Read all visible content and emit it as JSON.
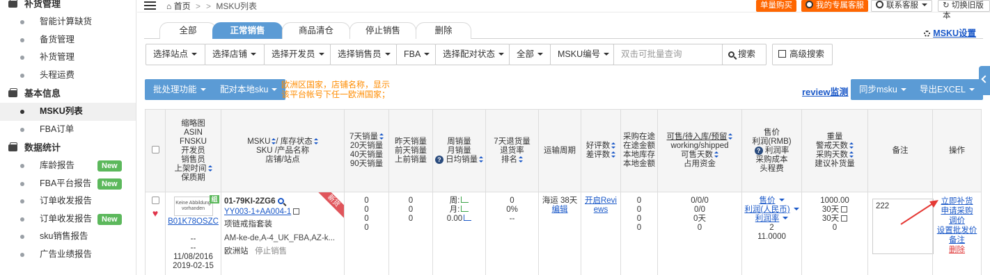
{
  "sidebar": {
    "sections": [
      {
        "title": "补货管理",
        "items": [
          {
            "label": "智能计算缺货",
            "new": ""
          },
          {
            "label": "备货管理",
            "new": ""
          },
          {
            "label": "补货管理",
            "new": ""
          },
          {
            "label": "头程运费",
            "new": ""
          }
        ]
      },
      {
        "title": "基本信息",
        "items": [
          {
            "label": "MSKU列表",
            "new": "",
            "active": true
          },
          {
            "label": "FBA订单",
            "new": ""
          }
        ]
      },
      {
        "title": "数据统计",
        "items": [
          {
            "label": "库龄报告",
            "new": "New"
          },
          {
            "label": "FBA平台报告",
            "new": "New"
          },
          {
            "label": "订单收发报告",
            "new": ""
          },
          {
            "label": "订单收发报告",
            "new": "New"
          },
          {
            "label": "sku销售报告",
            "new": ""
          },
          {
            "label": "广告业绩报告",
            "new": ""
          }
        ]
      }
    ]
  },
  "topbar": {
    "home": "首页",
    "sep1": ">",
    "sep2": ">",
    "current": "MSKU列表",
    "buy_btn": "单量购买",
    "service_btn": "我的专属客服",
    "contact_btn": "联系客服",
    "switch_btn": "切换旧版本"
  },
  "tabs": [
    {
      "label": "全部",
      "active": false
    },
    {
      "label": "正常销售",
      "active": true
    },
    {
      "label": "商品清仓",
      "active": false
    },
    {
      "label": "停止销售",
      "active": false
    },
    {
      "label": "删除",
      "active": false
    }
  ],
  "msku_settings": "MSKU设置",
  "filters": {
    "site": "选择站点",
    "shop": "选择店铺",
    "developer": "选择开发员",
    "seller": "选择销售员",
    "fba": "FBA",
    "match_status": "选择配对状态",
    "all": "全部",
    "msku_no": "MSKU编号",
    "search_placeholder": "双击可批量查询",
    "search_btn": "搜索",
    "advanced_btn": "高级搜索"
  },
  "actions": {
    "batch": "批处理功能",
    "pair": "配对本地sku",
    "note_line1": "欧洲区国家，店铺名称，显示",
    "note_line2": "该平台帐号下任一欧洲国家；",
    "review": "review监测",
    "sync": "同步msku",
    "export": "导出EXCEL"
  },
  "table": {
    "headers": {
      "thumb": [
        "缩略图",
        "ASIN",
        "FNSKU",
        "开发员",
        "销售员",
        "上架时间",
        "保质期"
      ],
      "msku": [
        "MSKU",
        "/ 库存状态",
        "SKU /产品名称",
        "店铺/站点"
      ],
      "sales7": [
        "7天销量",
        "20天销量",
        "40天销量",
        "90天销量"
      ],
      "yesterday": [
        "昨天销量",
        "前天销量",
        "上前销量"
      ],
      "weekly": [
        "周销量",
        "月销量",
        "日均销量"
      ],
      "returns": [
        "7天退货量",
        "退货率",
        "排名"
      ],
      "transport": "运输周期",
      "reviews": [
        "好评数",
        "差评数"
      ],
      "purchase": [
        "采购在途",
        "在途金额",
        "本地库存",
        "本地金额"
      ],
      "available": [
        "可售/待入库/预留",
        "working/shipped",
        "可售天数",
        "占用资金"
      ],
      "price": [
        "售价",
        "利润(RMB)",
        "利润率",
        "采购成本",
        "头程费"
      ],
      "weight": [
        "重量",
        "警戒天数",
        "采购天数",
        "建议补货量"
      ],
      "remark": "备注",
      "ops": "操作"
    },
    "row": {
      "thumb_text": "Keine Abbildung vorhanden",
      "group_tag": "组",
      "asin": "B01K78OSZC",
      "fnsku": "--",
      "developer": "--",
      "listed": "11/08/2016",
      "expiry": "2019-02-15",
      "msku": "01-79KI-2ZG6",
      "sku": "YY003-1+AA004-1",
      "product": "项链戒指套装",
      "shop": "AM-ke-de,A-4_UK_FBA,AZ-k...",
      "site": "欧洲站",
      "status": "停止销售",
      "new_ribbon": "新货",
      "sales": [
        "0",
        "0",
        "0",
        "0"
      ],
      "yesterday": [
        "0",
        "0",
        "0"
      ],
      "weekly": "周:",
      "monthly": "月:",
      "daily": "0.00",
      "returns": [
        "0",
        "0%",
        "--"
      ],
      "transport": "海运 38天",
      "transport_edit": "编辑",
      "reviews_link": "开启Reviews",
      "purchase": [
        "0",
        "0",
        "0",
        "0"
      ],
      "available": [
        "0/0/0",
        "0/0",
        "0天",
        "0"
      ],
      "price_link": "售价",
      "profit_link": "利润(人民币)",
      "margin_link": "利润率",
      "cost": "2",
      "freight": "11.0000",
      "weight": "1000.00",
      "alert_days": "30天",
      "purchase_days": "30天",
      "suggest": "0",
      "remark": "222",
      "ops": [
        "立即补货",
        "申请采购",
        "调价",
        "设置批发价",
        "备注",
        "删除"
      ]
    }
  }
}
